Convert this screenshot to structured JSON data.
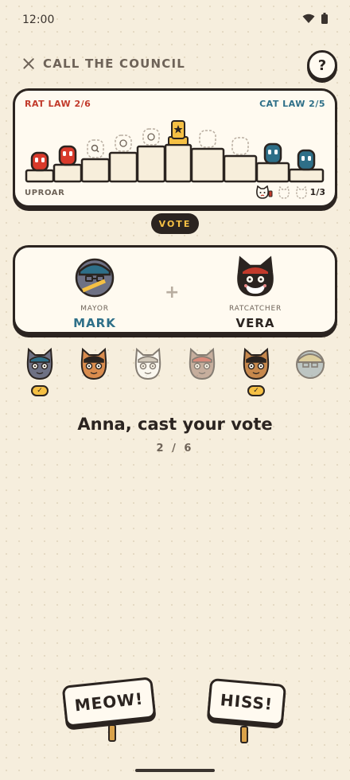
{
  "status_bar": {
    "time": "12:00"
  },
  "header": {
    "title": "CALL THE COUNCIL",
    "help_label": "?"
  },
  "law_track": {
    "rat_law": "RAT LAW 2/6",
    "cat_law": "CAT LAW 2/5",
    "uproar_label": "UPROAR",
    "uproar_count": "1/3"
  },
  "vote_label": "VOTE",
  "nomination": {
    "mayor": {
      "role": "MAYOR",
      "name": "MARK"
    },
    "ratcatcher": {
      "role": "RATCATCHER",
      "name": "VERA"
    }
  },
  "players": [
    {
      "voted": true,
      "fur": "#6e7184",
      "accent": "#2e6f88"
    },
    {
      "voted": false,
      "fur": "#d98c4e",
      "accent": "#2b2420"
    },
    {
      "voted": false,
      "fur": "#ffffff",
      "accent": "#b8ada0"
    },
    {
      "voted": false,
      "fur": "#a07a6a",
      "accent": "#c23a2b"
    },
    {
      "voted": true,
      "fur": "#c7884c",
      "accent": "#2b2420"
    },
    {
      "voted": false,
      "fur": "#8fa5ad",
      "accent": "#c9b46a"
    }
  ],
  "check_glyph": "✓",
  "prompt": "Anna, cast your vote",
  "progress": "2 / 6",
  "buttons": {
    "yes": "MEOW!",
    "no": "HISS!"
  },
  "colors": {
    "rat": "#c23a2b",
    "cat": "#2e6f88",
    "accent_gold": "#f5c044",
    "ink": "#2b2420",
    "paper": "#fffaf0",
    "background": "#f6eedd"
  }
}
